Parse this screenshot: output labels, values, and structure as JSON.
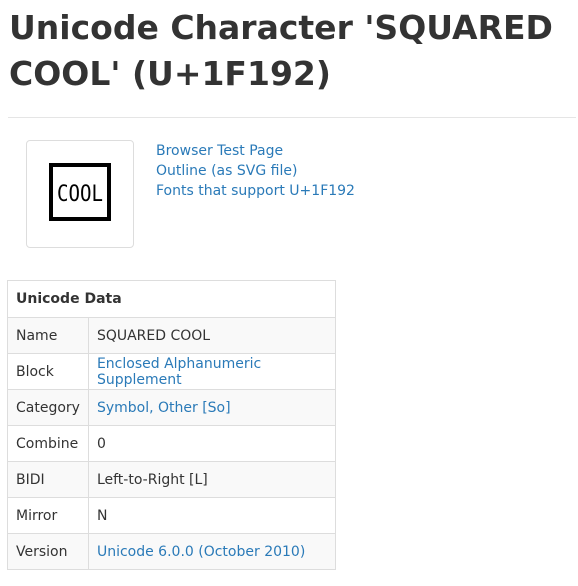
{
  "page": {
    "title": "Unicode Character 'SQUARED COOL' (U+1F192)"
  },
  "glyph": {
    "icon": "squared-cool-glyph",
    "text": "COOL"
  },
  "links": {
    "browser_test": "Browser Test Page",
    "outline_svg": "Outline (as SVG file)",
    "fonts_support": "Fonts that support U+1F192"
  },
  "table": {
    "header": "Unicode Data",
    "rows": [
      {
        "key": "Name",
        "value": "SQUARED COOL",
        "link": false
      },
      {
        "key": "Block",
        "value": "Enclosed Alphanumeric Supplement",
        "link": true
      },
      {
        "key": "Category",
        "value": "Symbol, Other [So]",
        "link": true
      },
      {
        "key": "Combine",
        "value": "0",
        "link": false
      },
      {
        "key": "BIDI",
        "value": "Left-to-Right [L]",
        "link": false
      },
      {
        "key": "Mirror",
        "value": "N",
        "link": false
      },
      {
        "key": "Version",
        "value": "Unicode 6.0.0 (October 2010)",
        "link": true
      }
    ]
  },
  "colors": {
    "link": "#2a7ab8",
    "text": "#333333",
    "border": "#dddddd"
  }
}
